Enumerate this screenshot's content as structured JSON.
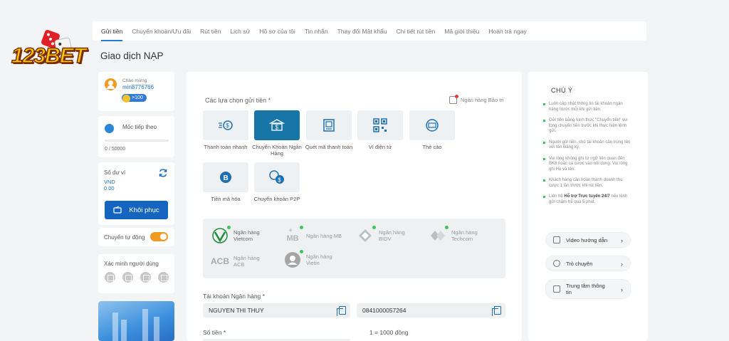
{
  "brand": {
    "logo_text": "123BET"
  },
  "nav": {
    "items": [
      "Gửi tiền",
      "Chuyển khoản/Ưu đãi",
      "Rút tiền",
      "Lịch sử",
      "Hồ sơ của tôi",
      "Tin nhắn",
      "Thay đổi Mật khẩu",
      "Chi tiết rút tiền",
      "Mã giới thiệu",
      "Hoàn trả ngay"
    ],
    "active": "Gửi tiền"
  },
  "page_title": "Giao dịch NẠP",
  "user": {
    "greeting": "Chào mừng",
    "username": "min8776766",
    "badge": ">100"
  },
  "progress": {
    "title": "Mốc tiếp theo",
    "value": "0 / 50000",
    "fraction": 0
  },
  "balance": {
    "title": "Số dư ví",
    "currency": "VND",
    "amount": "0.00",
    "restore_button": "Khôi phục"
  },
  "auto_transfer": {
    "label": "Chuyển tự động",
    "enabled": true
  },
  "verify": {
    "title": "Xác minh người dùng"
  },
  "deposit": {
    "methods_title": "Các lựa chọn gửi tiền *",
    "maintenance_label": "Ngân hàng Bảo trì",
    "methods": [
      {
        "label": "Thanh toán nhanh",
        "icon": "fast-pay-icon",
        "selected": false
      },
      {
        "label": "Chuyển Khoản Ngân Hàng",
        "icon": "bank-transfer-icon",
        "selected": true
      },
      {
        "label": "Quét mã thanh toán",
        "icon": "scan-pay-icon",
        "selected": false
      },
      {
        "label": "Ví điện tử",
        "icon": "qr-code-icon",
        "selected": false
      },
      {
        "label": "Thẻ cào",
        "icon": "scratch-card-icon",
        "selected": false
      },
      {
        "label": "Tiền mã hóa",
        "icon": "crypto-icon",
        "selected": false
      },
      {
        "label": "Chuyển khoản P2P",
        "icon": "p2p-icon",
        "selected": false
      }
    ],
    "banks": [
      {
        "name": "Ngân hàng Vietcom",
        "logo": "Vietcom"
      },
      {
        "name": "Ngân hàng MB",
        "logo": "MB"
      },
      {
        "name": "Ngân hàng BIDV",
        "logo": "BIDV"
      },
      {
        "name": "Ngân hàng Techcom",
        "logo": "Techcom"
      },
      {
        "name": "Ngân hàng ACB",
        "logo": "ACB"
      },
      {
        "name": "Ngân hàng Vietin",
        "logo": "Vietin"
      }
    ],
    "account_label": "Tài khoản Ngân hàng *",
    "account_name": "NGUYEN THI THUY",
    "account_number": "0841000057264",
    "amount_label": "Số tiền *",
    "rate_text": "1 = 1000 đồng"
  },
  "notice": {
    "title": "CHÚ Ý",
    "items": [
      {
        "pre": "Luôn cập nhật thông tin tài khoản ngân hàng trước mỗi khi gửi tiền.",
        "bold": "",
        "post": ""
      },
      {
        "pre": "Gửi tiền bằng hình thức \"Chuyển tiền\" vui lòng chuyển tiền trước khi thực hiện lệnh gửi.",
        "bold": "",
        "post": ""
      },
      {
        "pre": "Người gửi tiền, chủ tài khoản cần trùng tên với tên Đăng ký.",
        "bold": "",
        "post": ""
      },
      {
        "pre": "Vui lòng không ghi từ ngữ liên quan đến BK8 hoặc cá cược vào nội dung. Vui lòng ghi Họ và tên.",
        "bold": "",
        "post": ""
      },
      {
        "pre": "Khách hàng cần hoàn thành doanh thu cược 1 lần trước khi rút tiền.",
        "bold": "",
        "post": ""
      },
      {
        "pre": "Liên hệ ",
        "bold": "Hỗ trợ Trực tuyến 24/7",
        "post": " nếu lệnh gửi chậm trễ quá 5 phút."
      }
    ],
    "links": [
      {
        "label": "Video hướng dẫn",
        "icon": "video-icon"
      },
      {
        "label": "Trò chuyện",
        "icon": "chat-icon"
      },
      {
        "label": "Trung tâm thông tin",
        "icon": "info-center-icon"
      }
    ]
  }
}
